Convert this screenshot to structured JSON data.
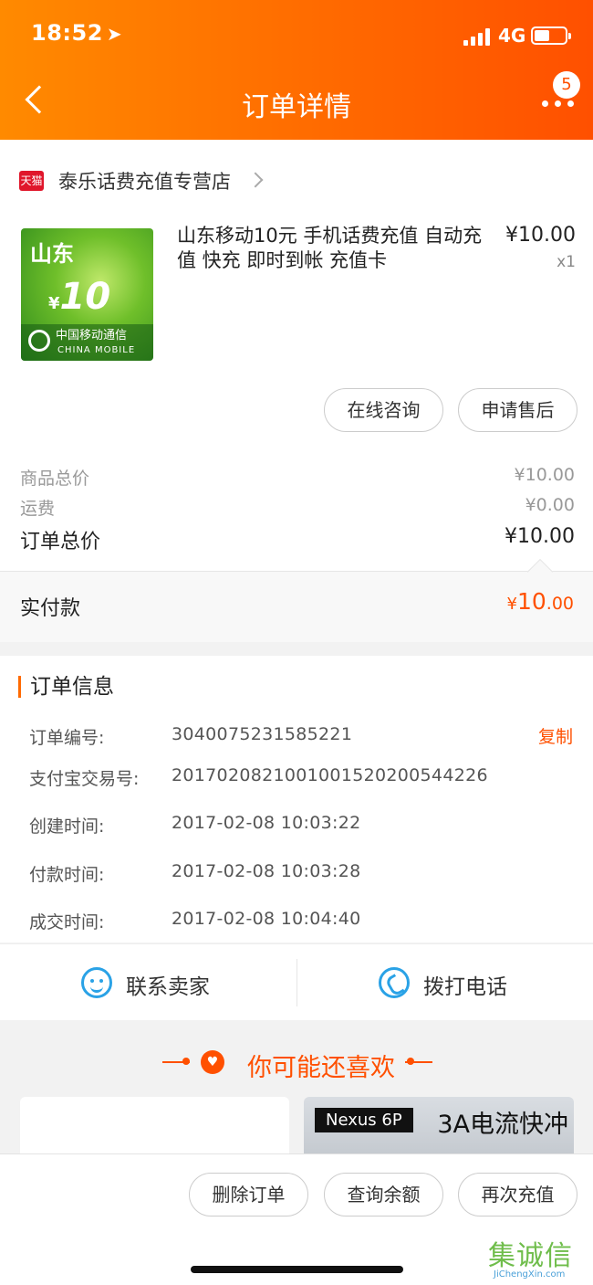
{
  "status_bar": {
    "time": "18:52",
    "network": "4G"
  },
  "nav": {
    "title": "订单详情",
    "badge_count": "5"
  },
  "shop": {
    "icon_label": "天猫",
    "name": "泰乐话费充值专营店"
  },
  "product": {
    "title": "山东移动10元 手机话费充值 自动充值 快充 即时到帐 充值卡",
    "price": "¥10.00",
    "quantity": "x1",
    "image": {
      "province": "山东",
      "amount": "10",
      "currency": "¥",
      "brand_cn": "中国移动通信",
      "brand_en": "CHINA MOBILE"
    }
  },
  "actions": {
    "consult": "在线咨询",
    "after_sale": "申请售后"
  },
  "price_summary": {
    "goods_label": "商品总价",
    "goods_value": "¥10.00",
    "shipping_label": "运费",
    "shipping_value": "¥0.00",
    "total_label": "订单总价",
    "total_value": "¥10.00",
    "paid_label": "实付款",
    "paid_currency": "¥",
    "paid_int": "10",
    "paid_dec": ".00"
  },
  "order_info": {
    "title": "订单信息",
    "copy_label": "复制",
    "rows": [
      {
        "key": "订单编号:",
        "value": "3040075231585221"
      },
      {
        "key": "支付宝交易号:",
        "value": "2017020821001001520200544226"
      },
      {
        "key": "创建时间:",
        "value": "2017-02-08 10:03:22"
      },
      {
        "key": "付款时间:",
        "value": "2017-02-08 10:03:28"
      },
      {
        "key": "成交时间:",
        "value": "2017-02-08 10:04:40"
      }
    ]
  },
  "contact": {
    "seller": "联系卖家",
    "call": "拨打电话"
  },
  "recommend": {
    "title": "你可能还喜欢",
    "card_tag": "Nexus 6P",
    "card_text": "3A电流快冲"
  },
  "bottom_actions": {
    "delete": "删除订单",
    "balance": "查询余额",
    "recharge": "再次充值"
  },
  "watermark": {
    "zh": "集诚信",
    "en": "JiChengXin.com"
  },
  "colors": {
    "accent": "#ff5000",
    "header_start": "#ff8a00",
    "icon_blue": "#2aa2e6"
  }
}
